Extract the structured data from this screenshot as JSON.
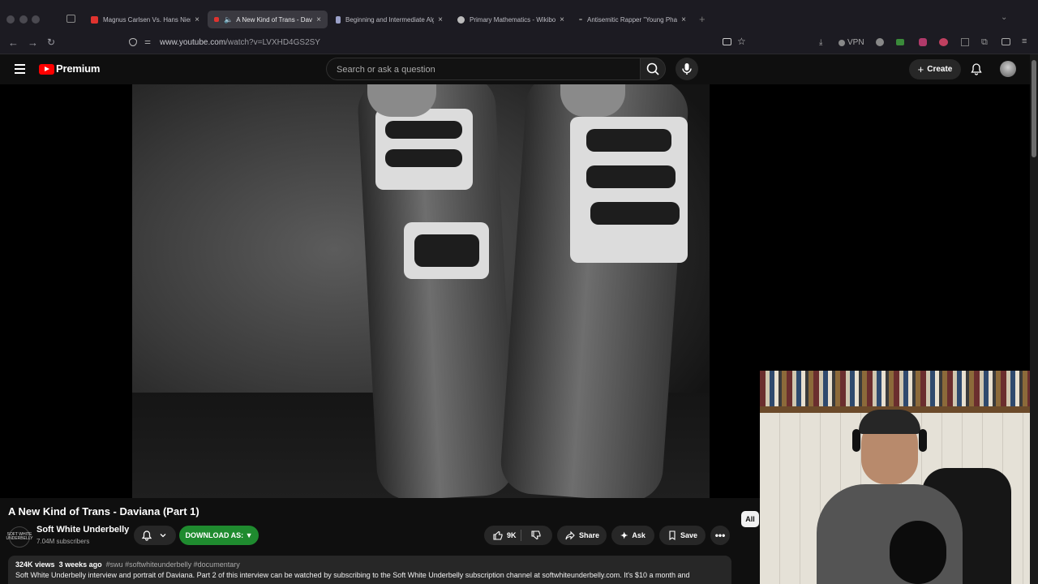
{
  "browser": {
    "tabs": [
      {
        "title": "Magnus Carlsen Vs. Hans Niemann",
        "favicon_color": "#e0332f"
      },
      {
        "title": "A New Kind of Trans - Daviana",
        "favicon_color": "#e0332f",
        "active": true
      },
      {
        "title": "Beginning and Intermediate Algebra",
        "favicon_color": "#9aa0c8"
      },
      {
        "title": "Primary Mathematics - Wikibooks",
        "favicon_color": "#bbbbbb"
      },
      {
        "title": "Antisemitic Rapper \"Young Pharaoh\"",
        "favicon_color": "#777777"
      }
    ],
    "url_host": "www.youtube.com",
    "url_path": "/watch?v=LVXHD4GS2SY",
    "vpn_label": "VPN"
  },
  "header": {
    "logo_text": "Premium",
    "search_placeholder": "Search or ask a question",
    "create_label": "Create"
  },
  "video": {
    "title": "A New Kind of Trans - Daviana (Part 1)",
    "channel_name": "Soft White Underbelly",
    "channel_avatar_text": "SOFT WHITE UNDERBELLY",
    "subscribers": "7.04M subscribers",
    "download_label": "DOWNLOAD AS: ▼",
    "likes": "9K",
    "share_label": "Share",
    "ask_label": "Ask",
    "save_label": "Save",
    "chip_all": "All",
    "views": "324K views",
    "age": "3 weeks ago",
    "hashtags": "#swu #softwhiteunderbelly #documentary",
    "description": "Soft White Underbelly interview and portrait of Daviana. Part 2 of this interview can be watched by subscribing to the Soft White Underbelly subscription channel at softwhiteunderbelly.com. It's $10 a month and"
  },
  "colors": {
    "youtube_red": "#ff0000",
    "download_green": "#1f8b2f",
    "background": "#0f0f0f"
  }
}
